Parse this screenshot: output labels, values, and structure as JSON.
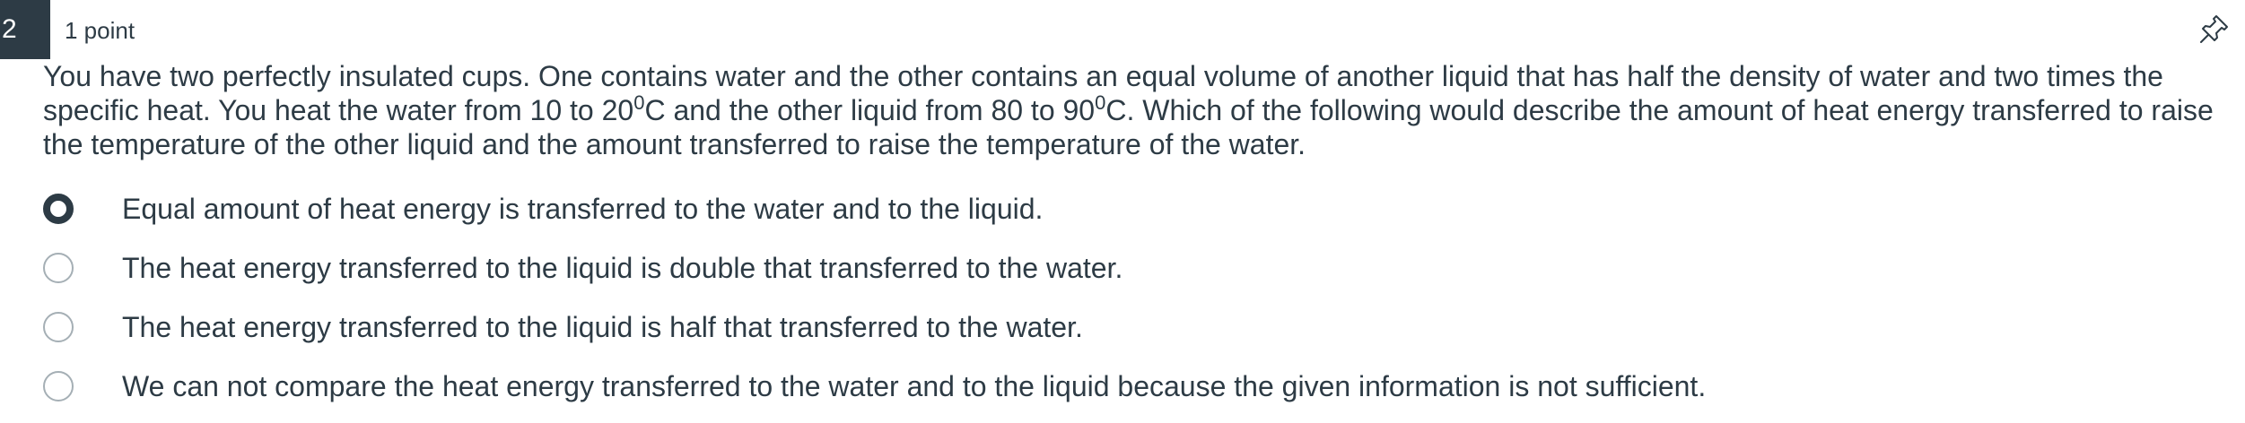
{
  "question": {
    "number": "2",
    "points": "1 point",
    "text_parts": {
      "p1": "You have two perfectly insulated cups. One contains water and the other contains an equal volume of another liquid that has half the density of water and two times the specific heat. You heat the water from 10 to 20",
      "sup1": "0",
      "p2": "C and the other liquid from 80 to 90",
      "sup2": "0",
      "p3": "C. Which of the following would describe the amount of heat energy transferred to raise the temperature of the other liquid and the amount transferred to raise the temperature of the water."
    },
    "answers": [
      {
        "label": "Equal amount of heat energy is transferred to the water and to the liquid.",
        "selected": true
      },
      {
        "label": "The heat energy transferred to the liquid is double that transferred to the water.",
        "selected": false
      },
      {
        "label": "The heat energy transferred to the liquid is half that transferred to the water.",
        "selected": false
      },
      {
        "label": "We can not compare the heat energy transferred to the water and to the liquid because the given information is not sufficient.",
        "selected": false
      }
    ]
  },
  "icons": {
    "pin": "pin-icon",
    "radio": "radio-button"
  },
  "colors": {
    "header_bg": "#2d3b45",
    "text": "#2d3b45",
    "radio_border": "#a5afb5"
  }
}
